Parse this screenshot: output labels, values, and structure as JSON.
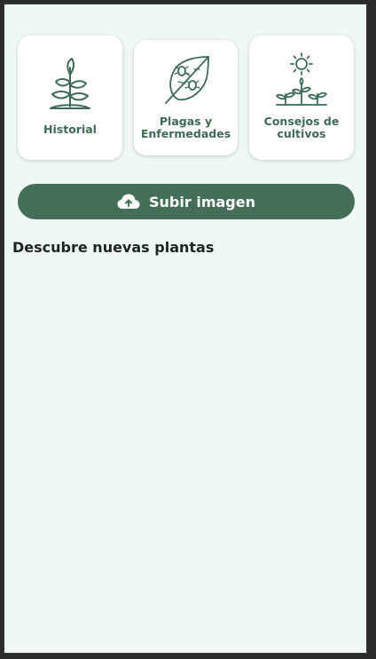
{
  "cards": [
    {
      "label": "Historial",
      "icon": "plant-sprout-icon"
    },
    {
      "label": "Plagas y\nEnfermedades",
      "icon": "leaf-bugs-icon"
    },
    {
      "label": "Consejos de\ncultivos",
      "icon": "sun-crops-icon"
    }
  ],
  "upload": {
    "label": "Subir imagen",
    "icon": "cloud-upload-icon"
  },
  "discover": {
    "title": "Descubre nuevas plantas"
  },
  "colors": {
    "accent": "#456e58",
    "icon_green": "#3f6b55",
    "background": "#f0f7f7",
    "card": "#ffffff"
  }
}
